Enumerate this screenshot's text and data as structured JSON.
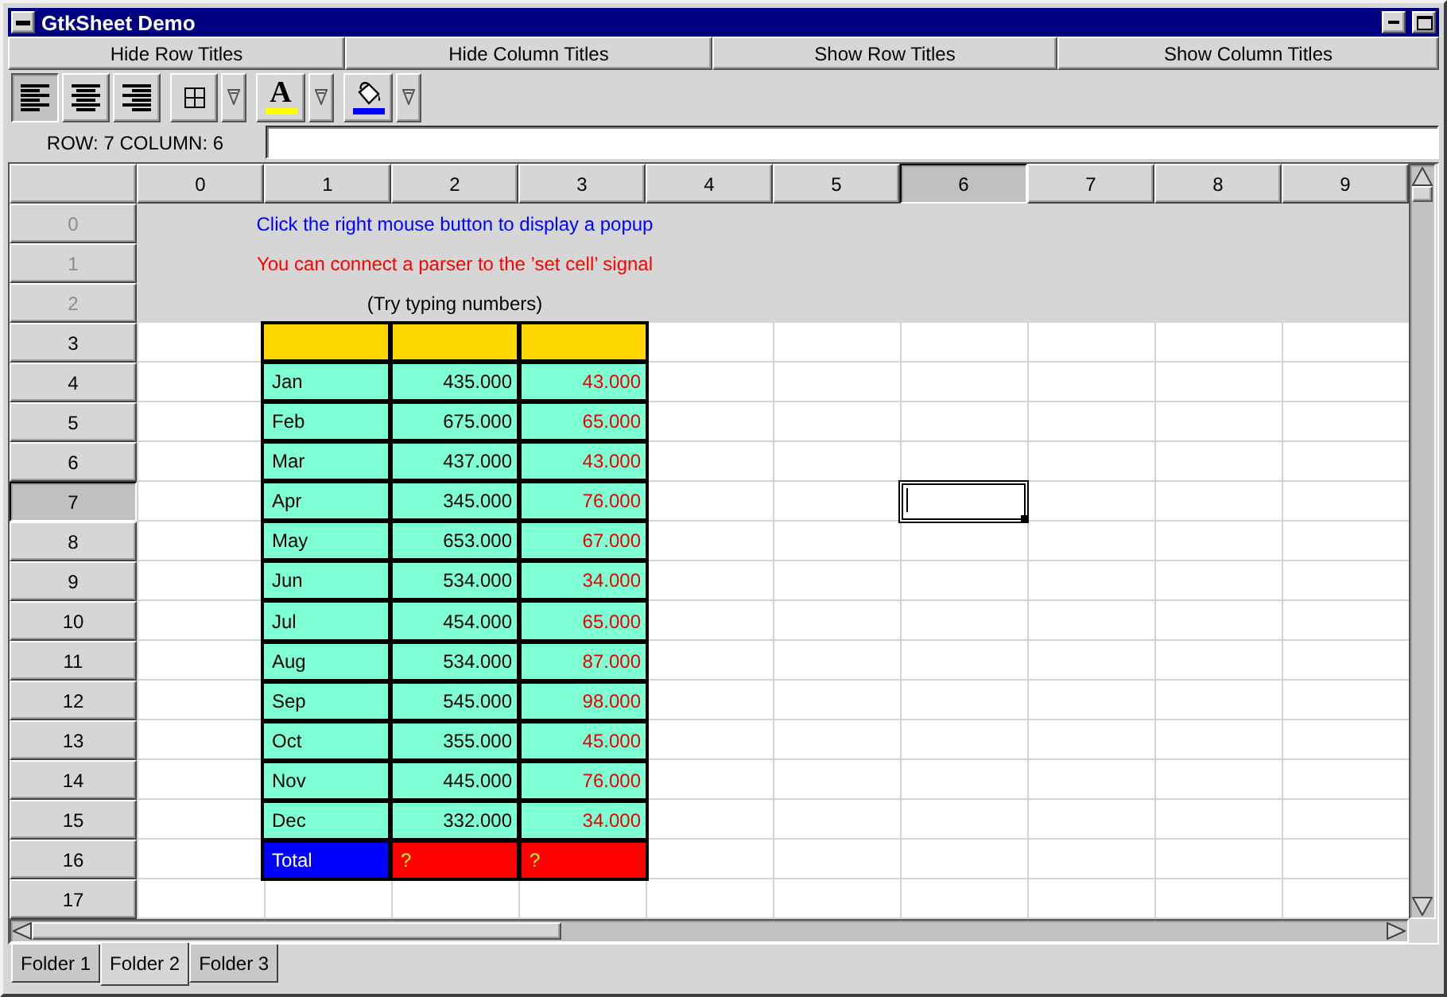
{
  "window": {
    "title": "GtkSheet Demo"
  },
  "buttons": [
    "Hide Row Titles",
    "Hide Column Titles",
    "Show Row Titles",
    "Show Column Titles"
  ],
  "align_buttons": [
    {
      "kind": "left",
      "selected": true
    },
    {
      "kind": "center",
      "selected": false
    },
    {
      "kind": "right",
      "selected": false
    }
  ],
  "tool_buttons": [
    {
      "kind": "borders"
    },
    {
      "kind": "text-color",
      "glyph": "A",
      "color": "#ffff00"
    },
    {
      "kind": "fill-color",
      "color": "#0000ff"
    }
  ],
  "position": {
    "label": "ROW: 7 COLUMN: 6"
  },
  "sheet": {
    "columns": [
      {
        "label": "0",
        "selected": false
      },
      {
        "label": "1",
        "selected": false
      },
      {
        "label": "2",
        "selected": false
      },
      {
        "label": "3",
        "selected": false
      },
      {
        "label": "4",
        "selected": false
      },
      {
        "label": "5",
        "selected": false
      },
      {
        "label": "6",
        "selected": true
      },
      {
        "label": "7",
        "selected": false
      },
      {
        "label": "8",
        "selected": false
      },
      {
        "label": "9",
        "selected": false
      }
    ],
    "rows": [
      {
        "label": "0",
        "dimmed": true,
        "selected": false
      },
      {
        "label": "1",
        "dimmed": true,
        "selected": false
      },
      {
        "label": "2",
        "dimmed": true,
        "selected": false
      },
      {
        "label": "3",
        "dimmed": false,
        "selected": false
      },
      {
        "label": "4",
        "dimmed": false,
        "selected": false
      },
      {
        "label": "5",
        "dimmed": false,
        "selected": false
      },
      {
        "label": "6",
        "dimmed": false,
        "selected": false
      },
      {
        "label": "7",
        "dimmed": false,
        "selected": true
      },
      {
        "label": "8",
        "dimmed": false,
        "selected": false
      },
      {
        "label": "9",
        "dimmed": false,
        "selected": false
      },
      {
        "label": "10",
        "dimmed": false,
        "selected": false
      },
      {
        "label": "11",
        "dimmed": false,
        "selected": false
      },
      {
        "label": "12",
        "dimmed": false,
        "selected": false
      },
      {
        "label": "13",
        "dimmed": false,
        "selected": false
      },
      {
        "label": "14",
        "dimmed": false,
        "selected": false
      },
      {
        "label": "15",
        "dimmed": false,
        "selected": false
      },
      {
        "label": "16",
        "dimmed": false,
        "selected": false
      },
      {
        "label": "17",
        "dimmed": false,
        "selected": false
      }
    ],
    "notes": [
      {
        "text": "Click the right mouse button to display a popup",
        "color": "#0000ff"
      },
      {
        "text": "You can connect a parser to the ’set cell’ signal",
        "color": "#ff0000"
      },
      {
        "text": "(Try typing numbers)",
        "color": "#000000"
      }
    ],
    "table": [
      {
        "kind": "heading"
      },
      {
        "kind": "month",
        "cells": [
          "Jan",
          "435.000",
          "43.000"
        ]
      },
      {
        "kind": "month",
        "cells": [
          "Feb",
          "675.000",
          "65.000"
        ]
      },
      {
        "kind": "month",
        "cells": [
          "Mar",
          "437.000",
          "43.000"
        ]
      },
      {
        "kind": "month",
        "cells": [
          "Apr",
          "345.000",
          "76.000"
        ]
      },
      {
        "kind": "month",
        "cells": [
          "May",
          "653.000",
          "67.000"
        ]
      },
      {
        "kind": "month",
        "cells": [
          "Jun",
          "534.000",
          "34.000"
        ]
      },
      {
        "kind": "month",
        "cells": [
          "Jul",
          "454.000",
          "65.000"
        ]
      },
      {
        "kind": "month",
        "cells": [
          "Aug",
          "534.000",
          "87.000"
        ]
      },
      {
        "kind": "month",
        "cells": [
          "Sep",
          "545.000",
          "98.000"
        ]
      },
      {
        "kind": "month",
        "cells": [
          "Oct",
          "355.000",
          "45.000"
        ]
      },
      {
        "kind": "month",
        "cells": [
          "Nov",
          "445.000",
          "76.000"
        ]
      },
      {
        "kind": "month",
        "cells": [
          "Dec",
          "332.000",
          "34.000"
        ]
      },
      {
        "kind": "total",
        "cells": [
          "Total",
          "?",
          "?"
        ]
      }
    ]
  },
  "tabs": [
    {
      "label": "Folder 1",
      "selected": false
    },
    {
      "label": "Folder 2",
      "selected": true
    },
    {
      "label": "Folder 3",
      "selected": false
    }
  ]
}
